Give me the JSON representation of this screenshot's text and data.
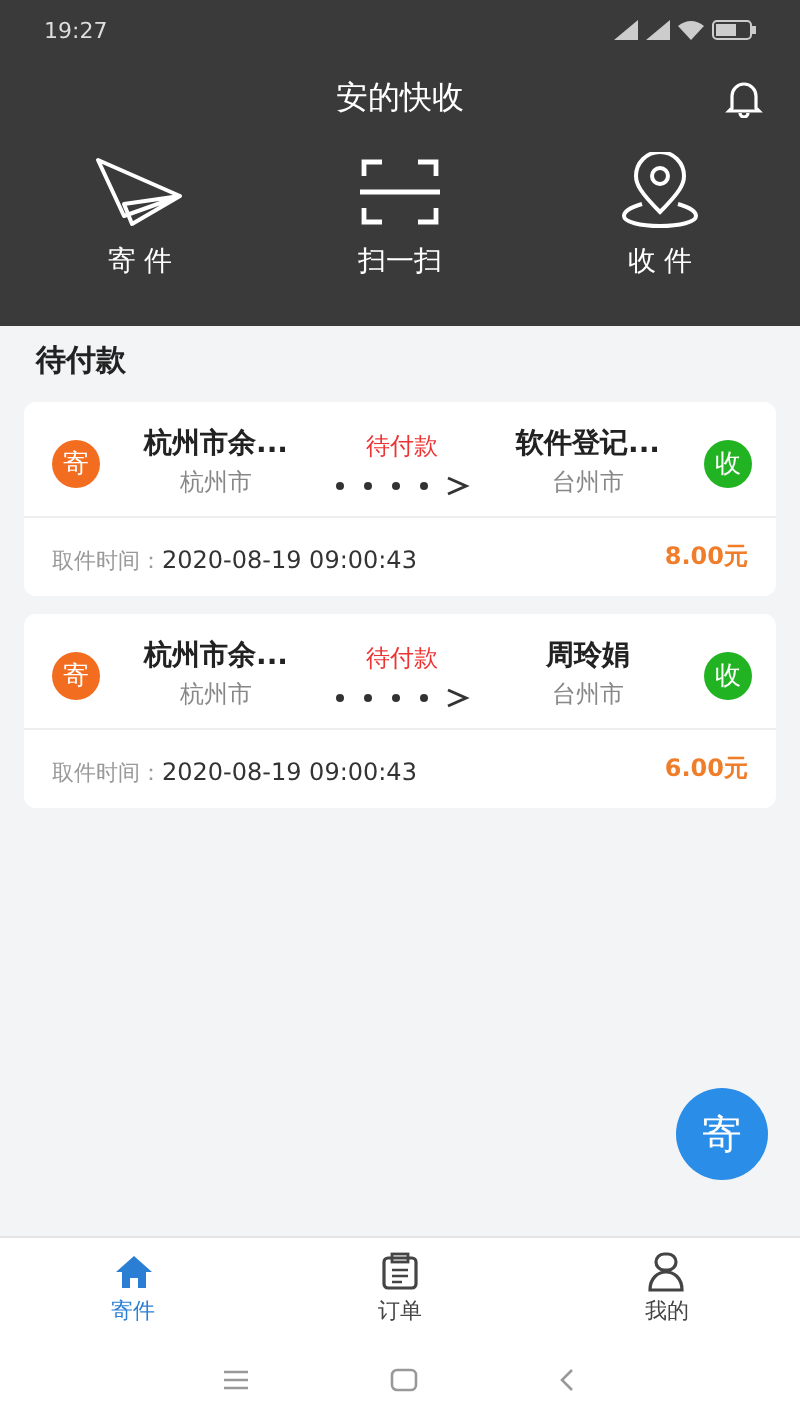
{
  "status_bar": {
    "time": "19:27"
  },
  "header": {
    "title": "安的快收"
  },
  "actions": [
    {
      "kind": "send",
      "label": "寄 件"
    },
    {
      "kind": "scan",
      "label": "扫一扫"
    },
    {
      "kind": "receive",
      "label": "收 件"
    }
  ],
  "section_title": "待付款",
  "orders": [
    {
      "sender_badge": "寄",
      "sender": "杭州市余...",
      "sender_city": "杭州市",
      "status": "待付款",
      "receiver": "软件登记...",
      "receiver_city": "台州市",
      "receiver_badge": "收",
      "time_label": "取件时间：",
      "time": "2020-08-19 09:00:43",
      "price": "8.00元"
    },
    {
      "sender_badge": "寄",
      "sender": "杭州市余...",
      "sender_city": "杭州市",
      "status": "待付款",
      "receiver": "周玲娟",
      "receiver_city": "台州市",
      "receiver_badge": "收",
      "time_label": "取件时间：",
      "time": "2020-08-19 09:00:43",
      "price": "6.00元"
    }
  ],
  "fab": "寄",
  "tabs": [
    {
      "kind": "home",
      "label": "寄件",
      "selected": true
    },
    {
      "kind": "orders",
      "label": "订单",
      "selected": false
    },
    {
      "kind": "profile",
      "label": "我的",
      "selected": false
    }
  ]
}
